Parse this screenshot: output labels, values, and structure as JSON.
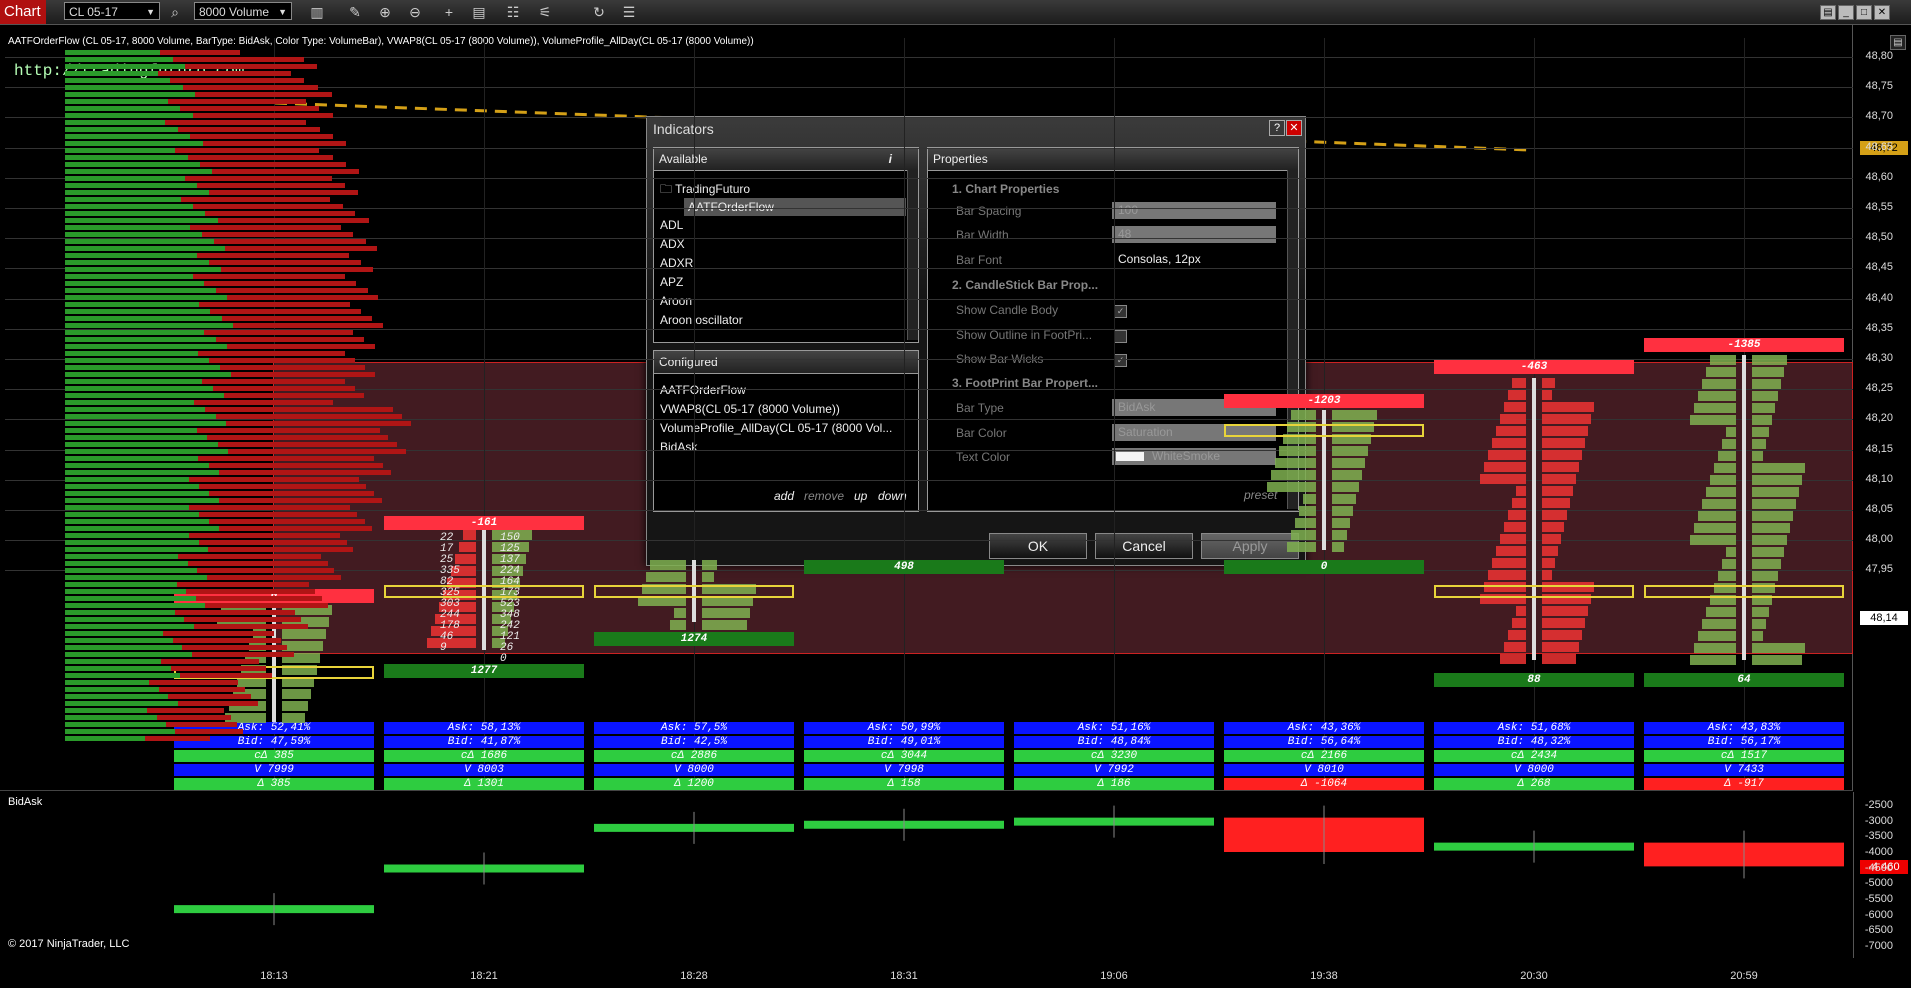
{
  "toolbar": {
    "title": "Chart",
    "instrument": "CL 05-17",
    "bar_type": "8000 Volume",
    "icons": [
      "search-icon",
      "bar-style-icon",
      "pencil-icon",
      "zoom-in-icon",
      "zoom-out-icon",
      "crosshair-icon",
      "properties-icon",
      "data-box-icon",
      "strategies-icon",
      "refresh-icon",
      "menu-icon"
    ]
  },
  "chart": {
    "header": "AATFOrderFlow (CL 05-17, 8000 Volume, BarType: BidAsk, Color Type: VolumeBar), VWAP8(CL 05-17 (8000 Volume)), VolumeProfile_AllDay(CL 05-17 (8000 Volume))",
    "watermark": "http://tradingfuturo.com",
    "price_labels": [
      "48,80",
      "48,75",
      "48,70",
      "48,65",
      "48,60",
      "48,55",
      "48,50",
      "48,45",
      "48,40",
      "48,35",
      "48,30",
      "48,25",
      "48,20",
      "48,15",
      "48,10",
      "48,05",
      "48,00",
      "47,95"
    ],
    "last_price_vwap": "48,72",
    "last_price": "48,14",
    "time_labels": [
      "18:13",
      "18:21",
      "18:28",
      "18:31",
      "19:06",
      "19:38",
      "20:30",
      "20:59"
    ],
    "bar_deltas": [
      "0",
      "-161",
      "",
      "",
      "",
      "-1203",
      "-463",
      "-1385"
    ],
    "poc_values": [
      "",
      "1277",
      "1274",
      "498",
      "",
      "0",
      "88",
      "64"
    ],
    "stats": [
      {
        "ask": "Ask: 52,41%",
        "bid": "Bid: 47,59%",
        "cd": "cΔ 385",
        "v": "V 7999",
        "d": "Δ 385",
        "neg": false
      },
      {
        "ask": "Ask: 58,13%",
        "bid": "Bid: 41,87%",
        "cd": "cΔ 1686",
        "v": "V 8003",
        "d": "Δ 1301",
        "neg": false
      },
      {
        "ask": "Ask: 57,5%",
        "bid": "Bid: 42,5%",
        "cd": "cΔ 2886",
        "v": "V 8000",
        "d": "Δ 1200",
        "neg": false
      },
      {
        "ask": "Ask: 50,99%",
        "bid": "Bid: 49,01%",
        "cd": "cΔ 3044",
        "v": "V 7998",
        "d": "Δ 158",
        "neg": false
      },
      {
        "ask": "Ask: 51,16%",
        "bid": "Bid: 48,84%",
        "cd": "cΔ 3230",
        "v": "V 7992",
        "d": "Δ 186",
        "neg": false
      },
      {
        "ask": "Ask: 43,36%",
        "bid": "Bid: 56,64%",
        "cd": "cΔ 2166",
        "v": "V 8010",
        "d": "Δ -1064",
        "neg": true
      },
      {
        "ask": "Ask: 51,68%",
        "bid": "Bid: 48,32%",
        "cd": "cΔ 2434",
        "v": "V 8000",
        "d": "Δ 268",
        "neg": false
      },
      {
        "ask": "Ask: 43,83%",
        "bid": "Bid: 56,17%",
        "cd": "cΔ 1517",
        "v": "V 7433",
        "d": "Δ -917",
        "neg": true
      }
    ],
    "footprint_sample_left": [
      "22",
      "17",
      "25",
      "335",
      "82",
      "325",
      "303",
      "244",
      "178",
      "46",
      "9"
    ],
    "footprint_sample_right": [
      "150",
      "125",
      "137",
      "224",
      "164",
      "173",
      "523",
      "348",
      "242",
      "121",
      "26",
      "0"
    ]
  },
  "bidask_panel": {
    "title": "BidAsk",
    "scale_labels": [
      "-2500",
      "-3000",
      "-3500",
      "-4000",
      "-4500",
      "-5000",
      "-5500",
      "-6000",
      "-6500",
      "-7000"
    ],
    "last_value": "-4.460",
    "copyright": "© 2017 NinjaTrader, LLC",
    "chart_data": {
      "type": "bar",
      "categories": [
        "18:13",
        "18:21",
        "18:28",
        "18:31",
        "19:06",
        "19:38",
        "20:30",
        "20:59"
      ],
      "series": [
        {
          "open": [
            -5700,
            -4400,
            -3100,
            -3000,
            -2900,
            -2900,
            -3900,
            -3700
          ],
          "close": [
            -5700,
            -4400,
            -3100,
            -3000,
            -2900,
            -4000,
            -3700,
            -4460
          ]
        }
      ],
      "ylim": [
        -7200,
        -2400
      ]
    }
  },
  "dialog": {
    "title": "Indicators",
    "help": "?",
    "close": "✕",
    "available": {
      "header": "Available",
      "info": "i",
      "folder": "TradingFuturo",
      "selected": "AATFOrderFlow",
      "items": [
        "ADL",
        "ADX",
        "ADXR",
        "APZ",
        "Aroon",
        "Aroon oscillator"
      ]
    },
    "configured": {
      "header": "Configured",
      "items": [
        "AATFOrderFlow",
        "VWAP8(CL 05-17 (8000 Volume))",
        "VolumeProfile_AllDay(CL 05-17 (8000 Vol...",
        "BidAsk"
      ],
      "links": {
        "add": "add",
        "remove": "remove",
        "up": "up",
        "down": "down"
      }
    },
    "properties": {
      "header": "Properties",
      "cat1": "1. Chart Properties",
      "bar_spacing_label": "Bar Spacing",
      "bar_spacing": "100",
      "bar_width_label": "Bar Width",
      "bar_width": "48",
      "bar_font_label": "Bar Font",
      "bar_font": "Consolas, 12px",
      "cat2": "2. CandleStick Bar Prop...",
      "show_body": "Show Candle Body",
      "show_outline": "Show Outline in FootPri...",
      "show_wicks": "Show Bar Wicks",
      "cat3": "3. FootPrint Bar Propert...",
      "bar_type_label": "Bar Type",
      "bar_type": "BidAsk",
      "bar_color_label": "Bar Color",
      "bar_color": "Saturation",
      "text_color_label": "Text Color",
      "text_color": "WhiteSmoke",
      "preset": "preset"
    },
    "buttons": {
      "ok": "OK",
      "cancel": "Cancel",
      "apply": "Apply"
    }
  },
  "colors": {
    "ask": "#0a14ff",
    "delta_pos": "#2ecc40",
    "delta_neg": "#ff2020",
    "range": "#7a3240",
    "vwap": "#d4a017"
  }
}
